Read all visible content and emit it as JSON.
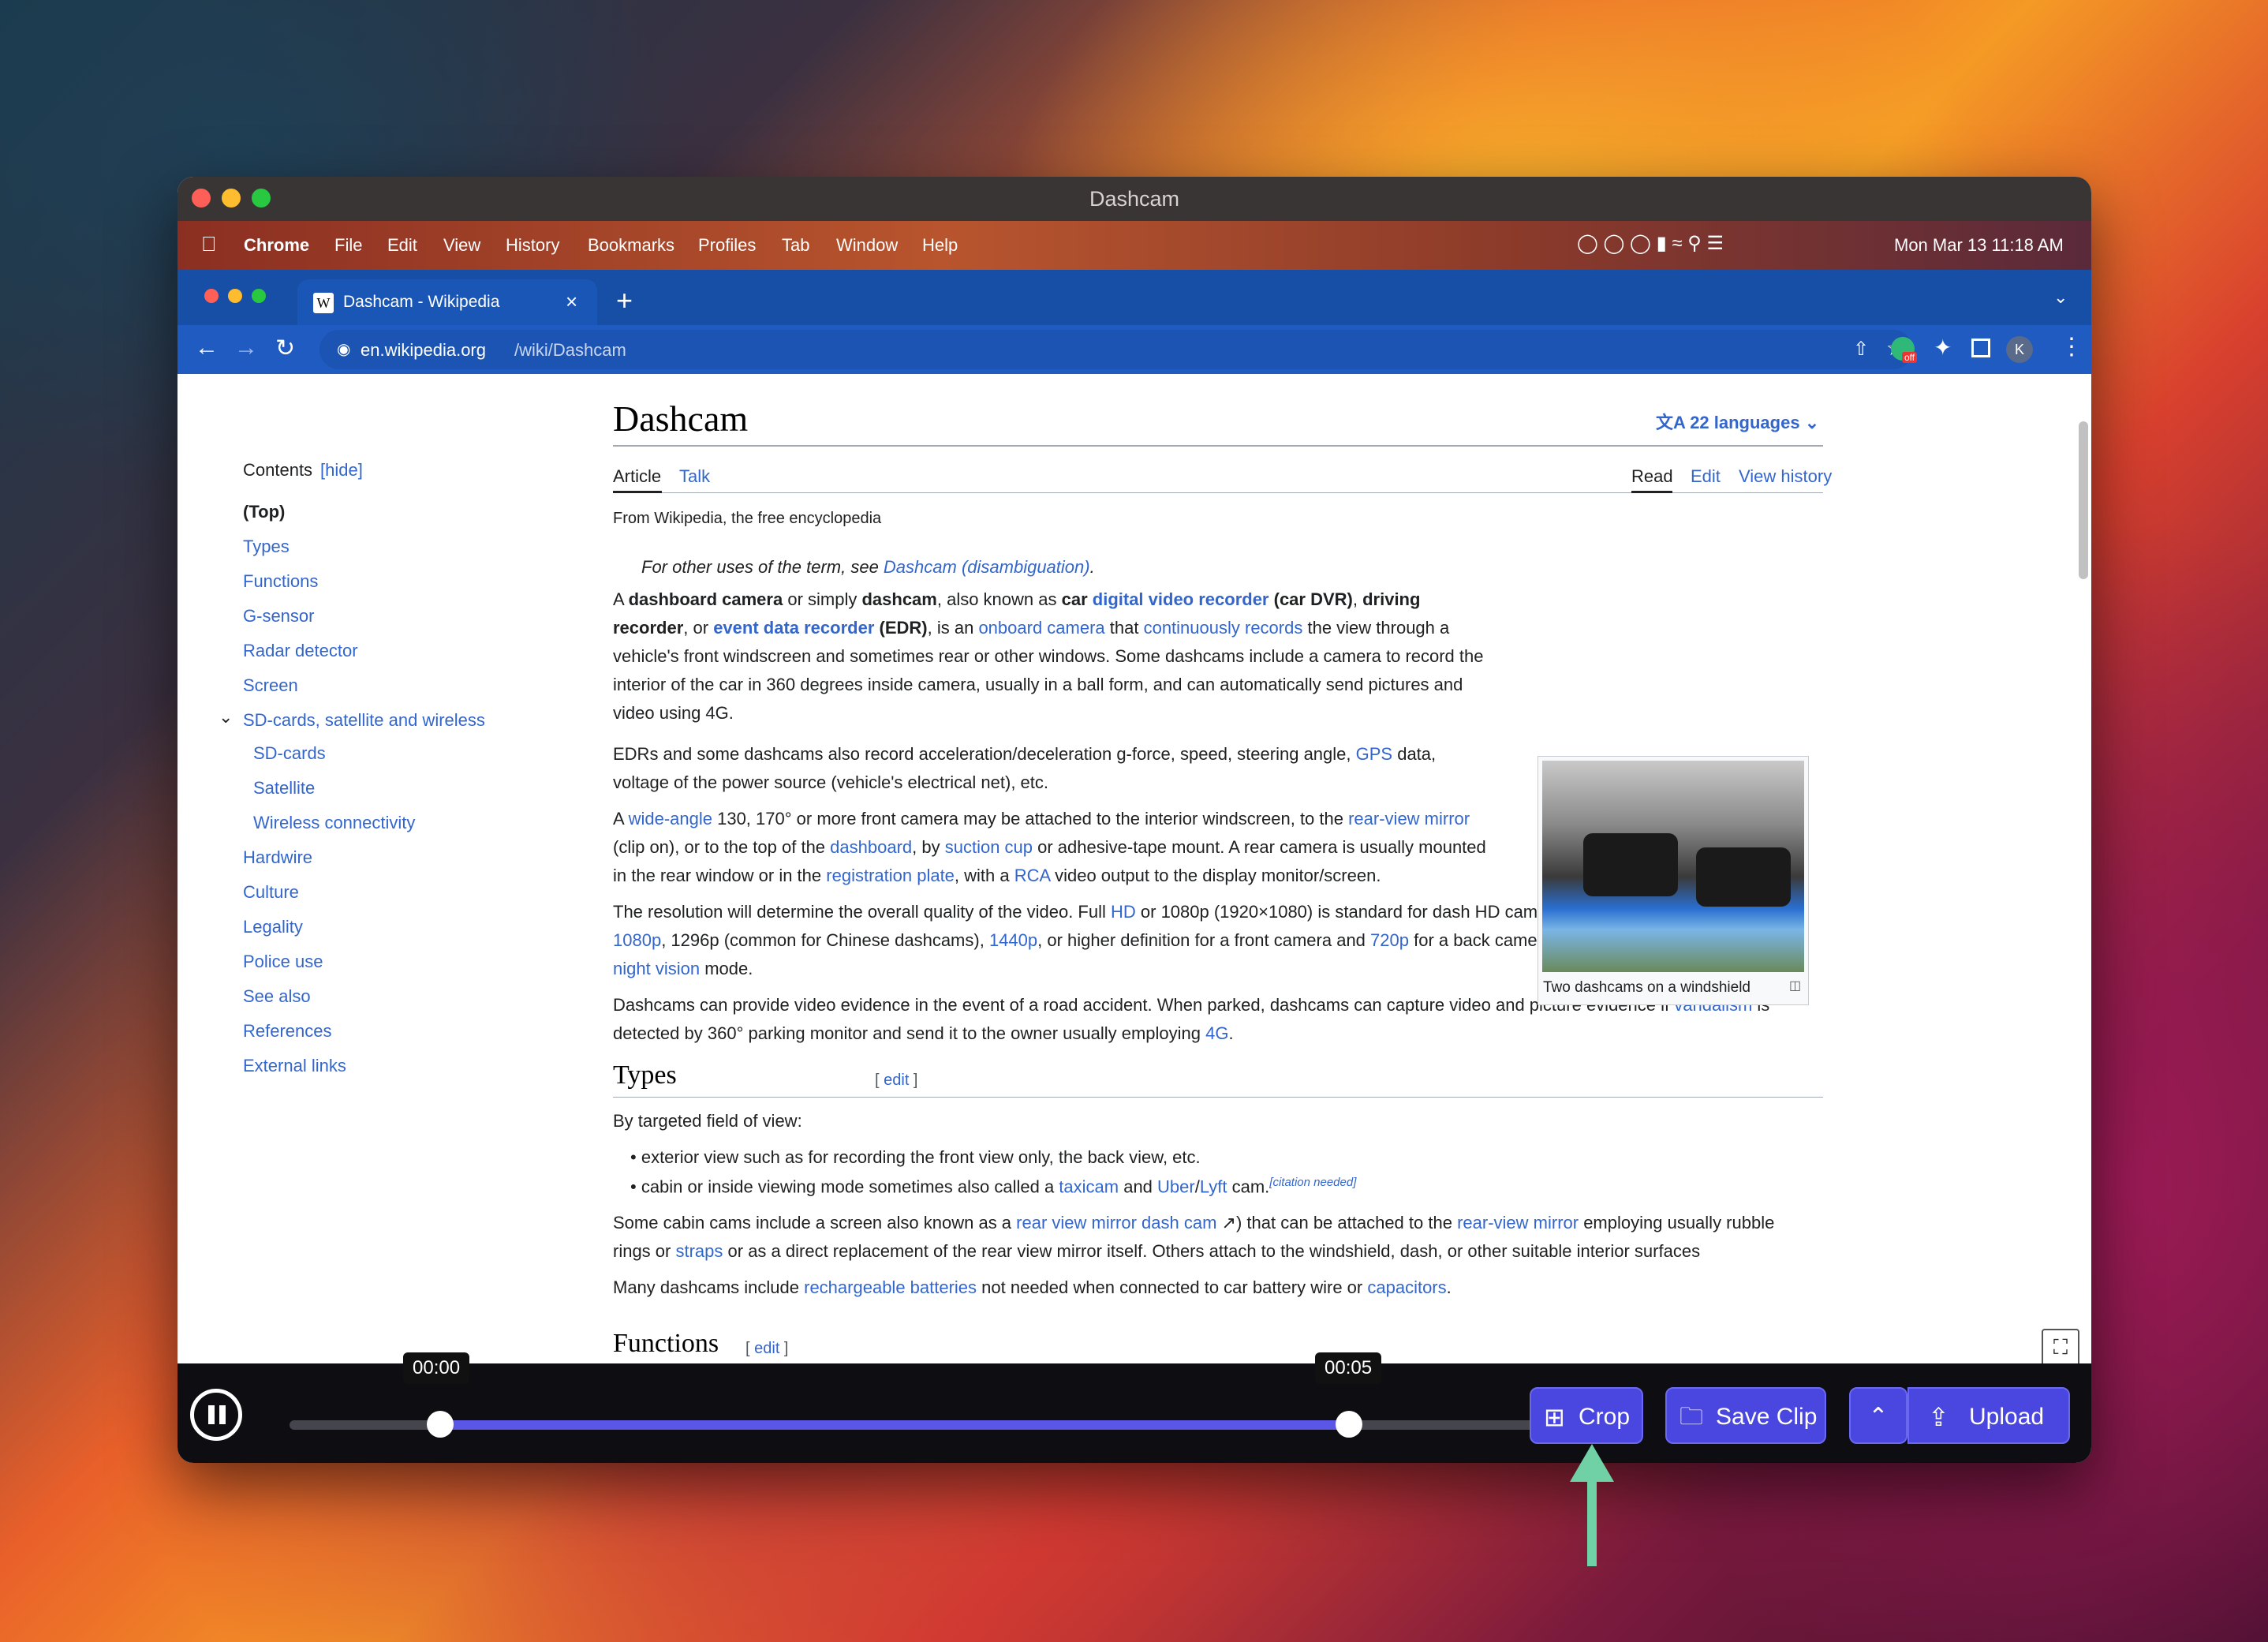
{
  "window_title": "Dashcam",
  "menubar": {
    "app": "Chrome",
    "items": [
      "File",
      "Edit",
      "View",
      "History",
      "Bookmarks",
      "Profiles",
      "Tab",
      "Window",
      "Help"
    ],
    "clock": "Mon Mar 13  11:18 AM"
  },
  "tab": {
    "title": "Dashcam - Wikipedia",
    "favicon": "W"
  },
  "address": {
    "domain": "en.wikipedia.org",
    "path": "/wiki/Dashcam"
  },
  "extension_badge": "off",
  "profile_initial": "K",
  "article": {
    "title": "Dashcam",
    "languages": "22 languages",
    "tabs_left": [
      "Article",
      "Talk"
    ],
    "tabs_right": [
      "Read",
      "Edit",
      "View history"
    ],
    "tagline": "From Wikipedia, the free encyclopedia",
    "hatnote_prefix": "For other uses of the term, see ",
    "hatnote_link": "Dashcam (disambiguation)",
    "hatnote_suffix": ".",
    "caption": "Two dashcams on a windshield",
    "types_heading": "Types",
    "functions_heading": "Functions",
    "edit_label": "edit",
    "types_intro": "By targeted field of view:",
    "bullet1": "exterior view such as for recording the front view only, the back view, etc.",
    "citation": "[citation needed]"
  },
  "contents": {
    "header": "Contents",
    "hide": "[hide]",
    "items": [
      "(Top)",
      "Types",
      "Functions",
      "G-sensor",
      "Radar detector",
      "Screen",
      "SD-cards, satellite and wireless",
      "SD-cards",
      "Satellite",
      "Wireless connectivity",
      "Hardwire",
      "Culture",
      "Legality",
      "Police use",
      "See also",
      "References",
      "External links"
    ]
  },
  "player": {
    "start_time": "00:00",
    "end_time": "00:05",
    "crop": "Crop",
    "save": "Save Clip",
    "upload": "Upload"
  },
  "colors": {
    "accent": "#4a46e0",
    "link": "#3366cc",
    "chrome_blue": "#174ea6",
    "arrow": "#6fd1a5"
  }
}
